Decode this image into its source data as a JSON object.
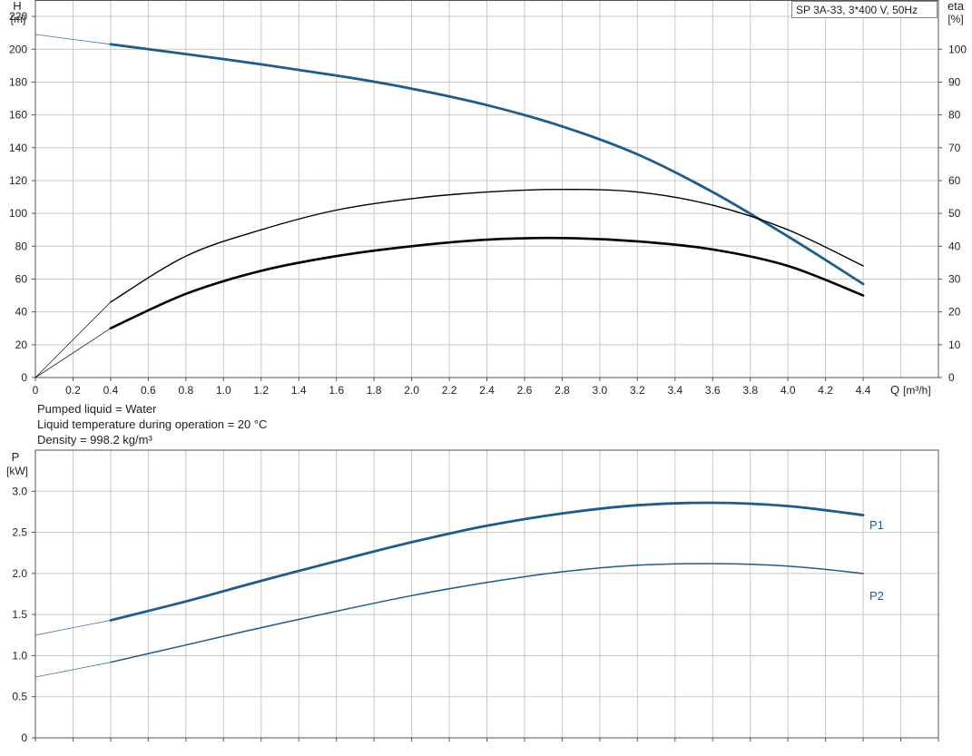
{
  "title": "SP 3A-33, 3*400 V, 50Hz",
  "notes": [
    "Pumped liquid = Water",
    "Liquid temperature during operation = 20 °C",
    "Density = 998.2 kg/m³"
  ],
  "chart_data": [
    {
      "type": "line",
      "title": "SP 3A-33, 3*400 V, 50Hz",
      "xlabel": "Q [m³/h]",
      "ylabel": "H [m]",
      "y2label": "eta [%]",
      "xlabel_parts": {
        "name": "Q",
        "unit": "[m³/h]"
      },
      "ylabel_parts": {
        "name": "H",
        "unit": "[m]"
      },
      "y2label_parts": {
        "name": "eta",
        "unit": "[%]"
      },
      "xlim": [
        0,
        4.8
      ],
      "ylim": [
        0,
        230
      ],
      "y2lim": [
        0,
        115
      ],
      "x_ticks": [
        "0",
        "0.2",
        "0.4",
        "0.6",
        "0.8",
        "1.0",
        "1.2",
        "1.4",
        "1.6",
        "1.8",
        "2.0",
        "2.2",
        "2.4",
        "2.6",
        "2.8",
        "3.0",
        "3.2",
        "3.4",
        "3.6",
        "3.8",
        "4.0",
        "4.2",
        "4.4"
      ],
      "y_ticks": [
        "0",
        "20",
        "40",
        "60",
        "80",
        "100",
        "120",
        "140",
        "160",
        "180",
        "200",
        "220"
      ],
      "y2_ticks": [
        "0",
        "10",
        "20",
        "30",
        "40",
        "50",
        "60",
        "70",
        "80",
        "90",
        "100"
      ],
      "grid": true,
      "series": [
        {
          "axis": "y",
          "color": "#1f5c8a",
          "width": 2.8,
          "x": [
            0,
            0.4,
            1.0,
            1.6,
            2.0,
            2.4,
            2.8,
            3.2,
            3.6,
            4.0,
            4.4
          ],
          "y": [
            209,
            203,
            194,
            184,
            176,
            166,
            153,
            136,
            113,
            86,
            57
          ],
          "operating_range": [
            0.4,
            4.4
          ]
        },
        {
          "axis": "y2",
          "color": "#000000",
          "width": 1.4,
          "x": [
            0,
            0.4,
            0.8,
            1.2,
            1.6,
            2.0,
            2.4,
            2.8,
            3.2,
            3.6,
            4.0,
            4.4
          ],
          "y": [
            0,
            23,
            37,
            45,
            51,
            54.5,
            56.5,
            57.3,
            56.5,
            52.5,
            45,
            34
          ],
          "operating_range": [
            0.4,
            4.4
          ]
        },
        {
          "axis": "y2",
          "color": "#000000",
          "width": 2.6,
          "x": [
            0,
            0.4,
            0.8,
            1.2,
            1.6,
            2.0,
            2.4,
            2.8,
            3.2,
            3.6,
            4.0,
            4.4
          ],
          "y": [
            0,
            15,
            25.5,
            32.5,
            37,
            40,
            42,
            42.5,
            41.5,
            39,
            34,
            25
          ],
          "operating_range": [
            0.4,
            4.4
          ]
        }
      ]
    },
    {
      "type": "line",
      "ylabel": "P [kW]",
      "ylabel_parts": {
        "name": "P",
        "unit": "[kW]"
      },
      "xlim": [
        0,
        4.8
      ],
      "ylim": [
        0,
        3.5
      ],
      "y_ticks": [
        "0",
        "0.5",
        "1.0",
        "1.5",
        "2.0",
        "2.5",
        "3.0"
      ],
      "grid": true,
      "series": [
        {
          "name": "P1",
          "color": "#1f5c8a",
          "width": 2.8,
          "x": [
            0,
            0.4,
            0.8,
            1.2,
            1.6,
            2.0,
            2.4,
            2.8,
            3.2,
            3.6,
            4.0,
            4.4
          ],
          "y": [
            1.25,
            1.43,
            1.66,
            1.91,
            2.15,
            2.38,
            2.58,
            2.73,
            2.83,
            2.86,
            2.82,
            2.71
          ],
          "operating_range": [
            0.4,
            4.4
          ]
        },
        {
          "name": "P2",
          "color": "#1f5c8a",
          "width": 1.5,
          "x": [
            0,
            0.4,
            0.8,
            1.2,
            1.6,
            2.0,
            2.4,
            2.8,
            3.2,
            3.6,
            4.0,
            4.4
          ],
          "y": [
            0.74,
            0.92,
            1.13,
            1.34,
            1.54,
            1.73,
            1.89,
            2.02,
            2.1,
            2.12,
            2.09,
            2.0
          ],
          "operating_range": [
            0.4,
            4.4
          ]
        }
      ]
    }
  ]
}
